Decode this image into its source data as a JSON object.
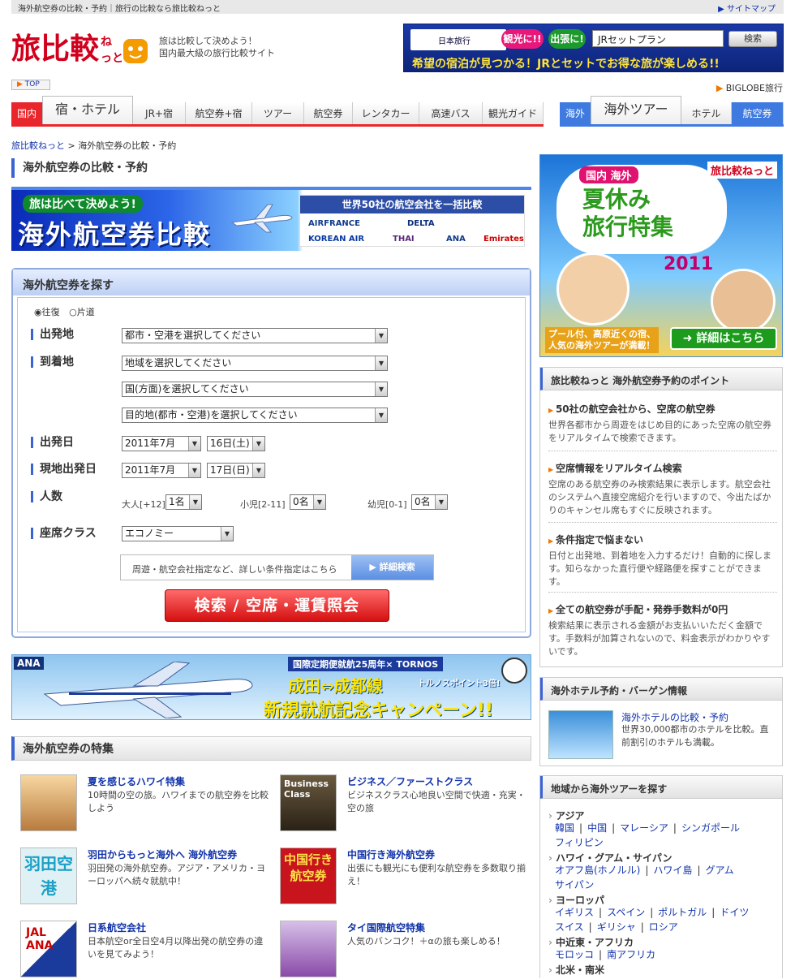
{
  "topbar": {
    "left_text": "海外航空券の比較・予約｜旅行の比較なら旅比較ねっと",
    "sitemap": "サイトマップ"
  },
  "header": {
    "logo_text": "旅比較ねっと",
    "tagline1": "旅は比較して決めよう！",
    "tagline2": "国内最大級の旅行比較サイト"
  },
  "ad": {
    "brand": "日本旅行",
    "chip1": "観光に!!",
    "chip2": "出張に!",
    "input_value": "JRセットプラン",
    "button": "検索",
    "message": "希望の宿泊が見つかる！JRとセットでお得な旅が楽しめる!!"
  },
  "top_button": "TOP",
  "biglobe": "BIGLOBE旅行",
  "domestic_tabs": {
    "label": "国内",
    "items": [
      "宿・ホテル",
      "JR+宿",
      "航空券+宿",
      "ツアー",
      "航空券",
      "レンタカー",
      "高速バス",
      "観光ガイド"
    ]
  },
  "overseas_tabs": {
    "label": "海外",
    "items": [
      "海外ツアー",
      "ホテル",
      "航空券"
    ]
  },
  "breadcrumb": {
    "home": "旅比較ねっと",
    "sep": ">",
    "current": "海外航空券の比較・予約"
  },
  "page_title": "海外航空券の比較・予約",
  "hero": {
    "tag": "旅は比べて決めよう!",
    "title": "海外航空券比較",
    "panel_title": "世界50社の航空会社を一括比較",
    "airlines": [
      "AIRFRANCE",
      "DELTA",
      "KOREAN AIR",
      "THAI",
      "ANA",
      "Emirates"
    ]
  },
  "search": {
    "title": "海外航空券を探す",
    "trip_types": [
      "往復",
      "片道"
    ],
    "labels": {
      "departure": "出発地",
      "arrival": "到着地",
      "depart_date": "出発日",
      "return_date": "現地出発日",
      "people": "人数",
      "seat": "座席クラス"
    },
    "departure_select": "都市・空港を選択してください",
    "region_select": "地域を選択してください",
    "country_select": "国(方面)を選択してください",
    "dest_select": "目的地(都市・空港)を選択してください",
    "depart_month": "2011年7月",
    "depart_day": "16日(土)",
    "return_month": "2011年7月",
    "return_day": "17日(日)",
    "adult_label": "大人[+12]",
    "adult_value": "1名",
    "child_label": "小児[2-11]",
    "child_value": "0名",
    "infant_label": "幼児[0-1]",
    "infant_value": "0名",
    "seat_value": "エコノミー",
    "detail_text": "周遊・航空会社指定など、詳しい条件指定はこちら",
    "detail_button": "詳細検索",
    "submit": "検索 / 空席・運賃照会"
  },
  "ana_banner": {
    "logo": "ANA",
    "line1": "国際定期便就航25周年× TORNOS",
    "line2": "成田⇔成都線",
    "bonus": "トルノスポイント3倍!",
    "line3": "新規就航記念キャンペーン!!"
  },
  "features": {
    "title": "海外航空券の特集",
    "items": [
      {
        "title": "夏を感じるハワイ特集",
        "desc": "10時間の空の旅。ハワイまでの航空券を比較しよう"
      },
      {
        "title": "ビジネス／ファーストクラス",
        "desc": "ビジネスクラス心地良い空間で快適・充実・空の旅",
        "img_text": "Business Class"
      },
      {
        "title": "羽田からもっと海外へ 海外航空券",
        "desc": "羽田発の海外航空券。アジア・アメリカ・ヨーロッパへ続々就航中！",
        "img_text": "羽田空港"
      },
      {
        "title": "中国行き海外航空券",
        "desc": "出張にも観光にも便利な航空券を多数取り揃え！",
        "img_text": "中国行き航空券"
      },
      {
        "title": "日系航空会社",
        "desc": "日本航空or全日空4月以降出発の航空券の違いを見てみよう！",
        "img_text": "JAL ANA"
      },
      {
        "title": "タイ国際航空特集",
        "desc": "人気のバンコク！＋αの旅も楽しめる！"
      }
    ]
  },
  "promo": {
    "logo": "旅比較ねっと",
    "tag": "国内 海外",
    "title1": "夏休み",
    "title2": "旅行特集",
    "year": "2011",
    "note1": "プール付、高原近くの宿、",
    "note2": "人気の海外ツアーが満載！",
    "button": "詳細はこちら"
  },
  "points": {
    "title": "旅比較ねっと 海外航空券予約のポイント",
    "items": [
      {
        "title": "50社の航空会社から、空席の航空券",
        "desc": "世界各都市から周遊をはじめ目的にあった空席の航空券をリアルタイムで検索できます。"
      },
      {
        "title": "空席情報をリアルタイム検索",
        "desc": "空席のある航空券のみ検索結果に表示します。航空会社のシステムへ直接空席紹介を行いますので、今出たばかりのキャンセル席もすぐに反映されます。"
      },
      {
        "title": "条件指定で悩まない",
        "desc": "日付と出発地、到着地を入力するだけ！自動的に探します。知らなかった直行便や経路便を探すことができます。"
      },
      {
        "title": "全ての航空券が手配・発券手数料が0円",
        "desc": "検索結果に表示される金額がお支払いいただく金額です。手数料が加算されないので、料金表示がわかりやすいです。"
      }
    ]
  },
  "hotel_box": {
    "title": "海外ホテル予約・バーゲン情報",
    "link": "海外ホテルの比較・予約",
    "desc": "世界30,000都市のホテルを比較。直前割引のホテルも満載。"
  },
  "region_box": {
    "title": "地域から海外ツアーを探す",
    "regions": [
      {
        "name": "アジア",
        "lines": [
          [
            "韓国",
            "中国",
            "マレーシア",
            "シンガポール"
          ],
          [
            "フィリピン"
          ]
        ]
      },
      {
        "name": "ハワイ・グアム・サイパン",
        "lines": [
          [
            "オアフ島(ホノルル)",
            "ハワイ島",
            "グアム"
          ],
          [
            "サイパン"
          ]
        ]
      },
      {
        "name": "ヨーロッパ",
        "lines": [
          [
            "イギリス",
            "スペイン",
            "ポルトガル",
            "ドイツ"
          ],
          [
            "スイス",
            "ギリシャ",
            "ロシア"
          ]
        ]
      },
      {
        "name": "中近東・アフリカ",
        "lines": [
          [
            "モロッコ",
            "南アフリカ"
          ]
        ]
      },
      {
        "name": "北米・南米",
        "lines": []
      }
    ]
  },
  "colors": {
    "brand_red": "#d1001c",
    "accent_blue": "#3a63d3",
    "link": "#1133aa",
    "domestic_tab": "#e8262b",
    "overseas_tab": "#3f7ae0"
  }
}
